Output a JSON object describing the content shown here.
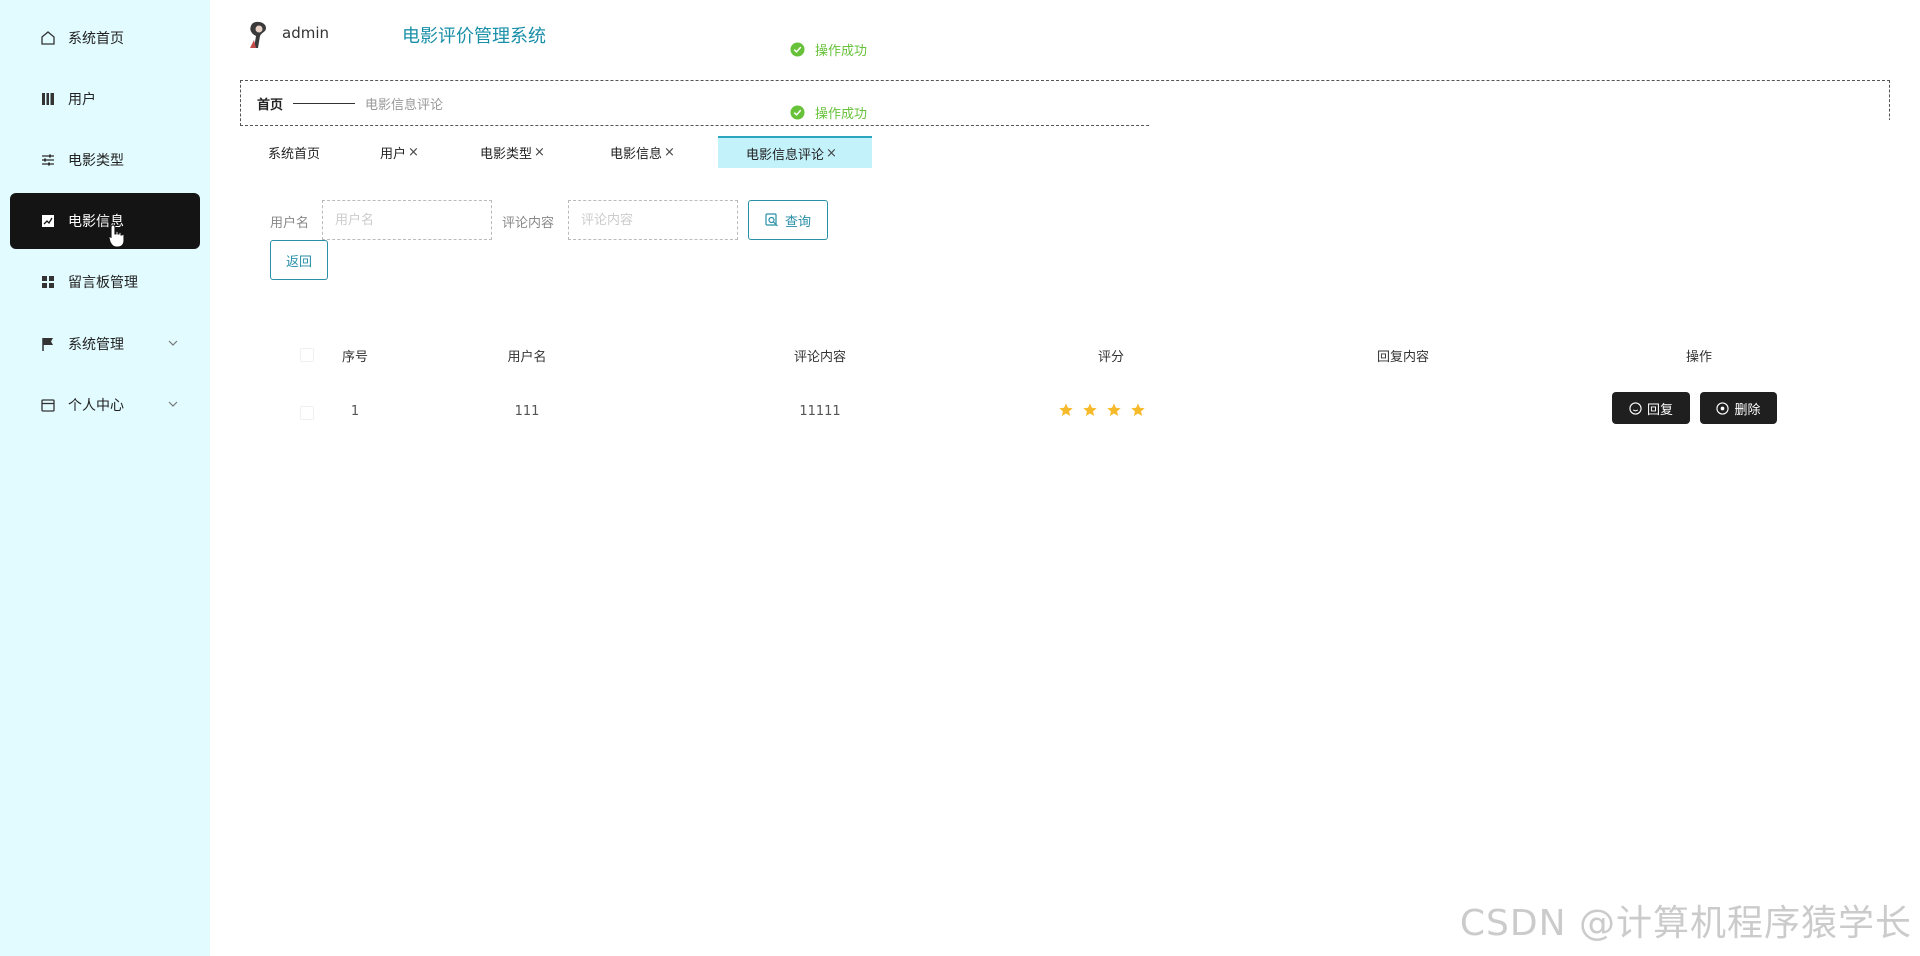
{
  "sidebar": {
    "items": [
      {
        "label": "系统首页",
        "icon": "home-icon"
      },
      {
        "label": "用户",
        "icon": "book-icon"
      },
      {
        "label": "电影类型",
        "icon": "sliders-icon"
      },
      {
        "label": "电影信息",
        "icon": "chart-icon",
        "active": true
      },
      {
        "label": "留言板管理",
        "icon": "grid-icon"
      },
      {
        "label": "系统管理",
        "icon": "flag-icon",
        "expandable": true
      },
      {
        "label": "个人中心",
        "icon": "window-icon",
        "expandable": true
      }
    ]
  },
  "header": {
    "username": "admin",
    "title": "电影评价管理系统"
  },
  "toasts": [
    "操作成功",
    "操作成功"
  ],
  "breadcrumb": {
    "home": "首页",
    "current": "电影信息评论"
  },
  "tabs": [
    {
      "label": "系统首页",
      "closable": false
    },
    {
      "label": "用户",
      "closable": true
    },
    {
      "label": "电影类型",
      "closable": true
    },
    {
      "label": "电影信息",
      "closable": true
    },
    {
      "label": "电影信息评论",
      "closable": true,
      "active": true
    }
  ],
  "close_glyph": "×",
  "search": {
    "username_label": "用户名",
    "username_placeholder": "用户名",
    "content_label": "评论内容",
    "content_placeholder": "评论内容",
    "query_button": "查询",
    "back_button": "返回"
  },
  "table": {
    "columns": [
      "序号",
      "用户名",
      "评论内容",
      "评分",
      "回复内容",
      "操作"
    ],
    "rows": [
      {
        "index": "1",
        "username": "111",
        "content": "11111",
        "rating": 4,
        "reply": "",
        "actions": {
          "reply": "回复",
          "delete": "删除"
        }
      }
    ]
  },
  "colors": {
    "sidebar_bg": "#e1fbff",
    "active_nav_bg": "#141414",
    "accent": "#2a8fa7",
    "success": "#67c23a",
    "star": "#f7ba2a"
  },
  "watermark": "CSDN @计算机程序猿学长"
}
